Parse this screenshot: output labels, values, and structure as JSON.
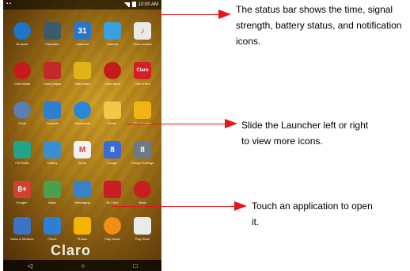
{
  "status_bar": {
    "time": "10:00 AM"
  },
  "apps": [
    {
      "label": "Browser",
      "icon": "globe-icon",
      "color": "#1e74c8",
      "round": true
    },
    {
      "label": "Calculator",
      "icon": "calculator-icon",
      "color": "#3d5a6a"
    },
    {
      "label": "Calendar",
      "icon": "calendar-icon",
      "color": "#2a76c9",
      "glyph": "31"
    },
    {
      "label": "Camera",
      "icon": "camera-icon",
      "color": "#3ba0e0"
    },
    {
      "label": "Claro música",
      "icon": "music-icon",
      "color": "#e9e9e9",
      "glyph": "♪"
    },
    {
      "label": "Claro ideas",
      "icon": "lightbulb-icon",
      "color": "#c51b1b",
      "round": true
    },
    {
      "label": "Claro juegos",
      "icon": "gamepad-icon",
      "color": "#c22a2a"
    },
    {
      "label": "Claro video",
      "icon": "trophy-icon",
      "color": "#e0b418"
    },
    {
      "label": "Claro apps",
      "icon": "eye-icon",
      "color": "#c51b1b",
      "round": true
    },
    {
      "label": "Claro Hero",
      "icon": "claro-icon",
      "color": "#d51f26",
      "glyph": "Claro"
    },
    {
      "label": "Clock",
      "icon": "clock-icon",
      "color": "#5b7fb2",
      "round": true
    },
    {
      "label": "Contacts",
      "icon": "contacts-icon",
      "color": "#2f7fd1"
    },
    {
      "label": "Downloads",
      "icon": "download-icon",
      "color": "#2a86d6",
      "round": true
    },
    {
      "label": "Email",
      "icon": "email-icon",
      "color": "#f3c74a"
    },
    {
      "label": "File Manager",
      "icon": "folder-icon",
      "color": "#f2b315"
    },
    {
      "label": "FM Radio",
      "icon": "radio-icon",
      "color": "#22a38a"
    },
    {
      "label": "Gallery",
      "icon": "gallery-icon",
      "color": "#3b8fd1"
    },
    {
      "label": "Gmail",
      "icon": "gmail-icon",
      "color": "#f1f1f1",
      "glyph": "M"
    },
    {
      "label": "Google",
      "icon": "google-icon",
      "color": "#3b6cd6",
      "glyph": "8"
    },
    {
      "label": "Google Settings",
      "icon": "settings-icon",
      "color": "#6c7a86",
      "glyph": "8"
    },
    {
      "label": "Google+",
      "icon": "google-plus-icon",
      "color": "#d2402f",
      "glyph": "8+"
    },
    {
      "label": "Maps",
      "icon": "maps-icon",
      "color": "#4da04b"
    },
    {
      "label": "Messaging",
      "icon": "messaging-icon",
      "color": "#3a82c6"
    },
    {
      "label": "Mi Claro",
      "icon": "android-icon",
      "color": "#c81e24"
    },
    {
      "label": "Music",
      "icon": "record-icon",
      "color": "#c91e21",
      "round": true
    }
  ],
  "dock": [
    {
      "label": "News & Weather",
      "icon": "news-icon",
      "color": "#3b74c4"
    },
    {
      "label": "Phone",
      "icon": "phone-icon",
      "color": "#2d7fd6"
    },
    {
      "label": "Photos",
      "icon": "photos-icon",
      "color": "#f5b400"
    },
    {
      "label": "Play Music",
      "icon": "headphones-icon",
      "color": "#f08f16",
      "round": true
    },
    {
      "label": "Play Store",
      "icon": "playstore-icon",
      "color": "#eaeaea"
    }
  ],
  "brand": "Claro",
  "callouts": {
    "status_bar": "The status bar shows the time, signal strength, battery status, and notification icons.",
    "launcher": "Slide the Launcher left or right to view more icons.",
    "application": "Touch an application to open it."
  },
  "accent_color": "#e8141a"
}
